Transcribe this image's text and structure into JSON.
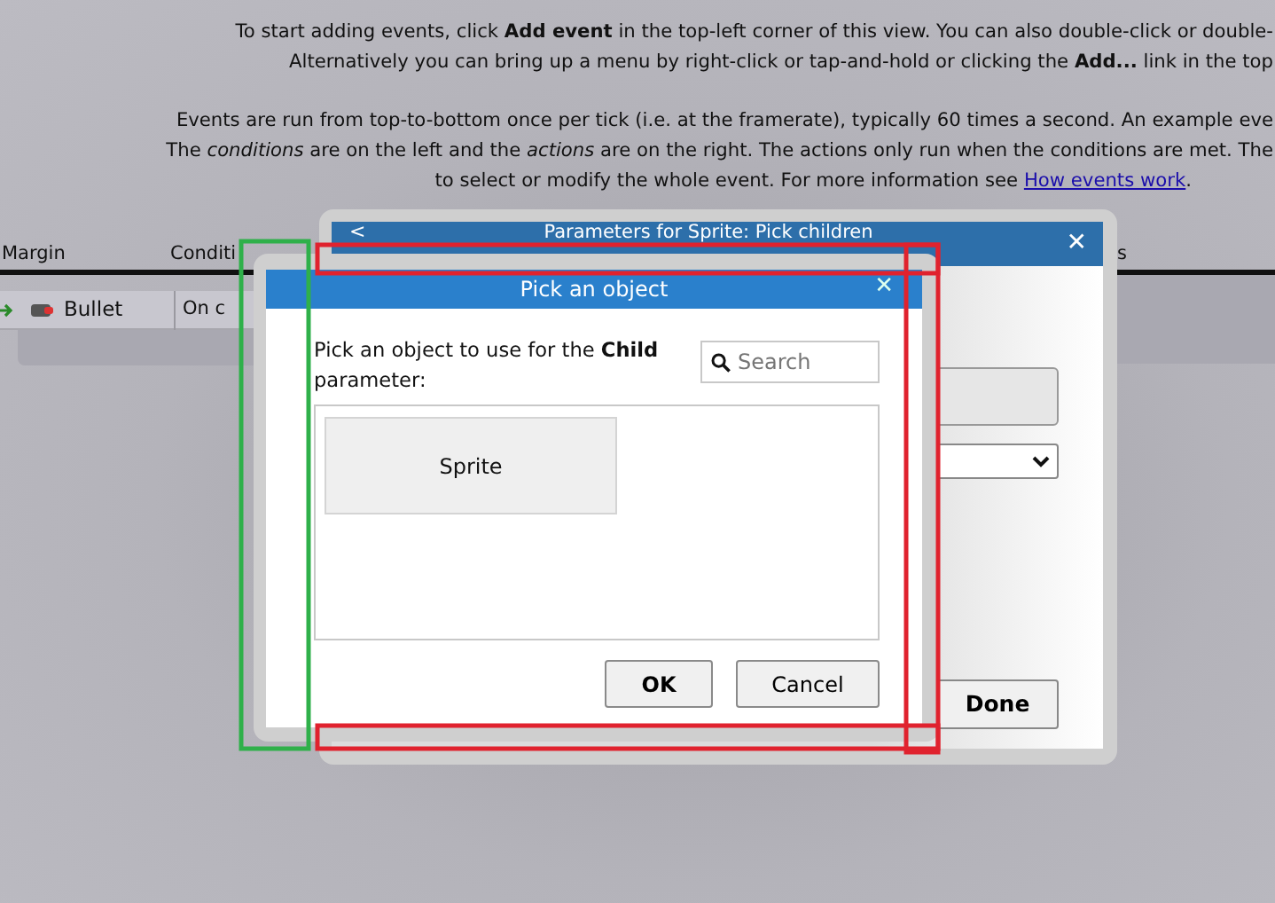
{
  "intro": [
    "To start adding events, click **Add event** in the top-left corner of this view. You can also double-click or double-",
    "Alternatively you can bring up a menu by right-click or tap-and-hold or clicking the **Add...** link in the top"
  ],
  "details": [
    {
      "text": "Events are run from top-to-bottom once per tick (i.e. at the framerate), typically 60 times a second. An example eve"
    },
    {
      "text": "The *conditions* are on the left and the *actions* are on the right. The actions only run when the conditions are met. The"
    },
    {
      "text": "to select or modify the whole event. For more information see",
      "link": "How events work",
      "after": "."
    }
  ],
  "event_sheet": {
    "columns": [
      "Margin",
      "Conditi",
      "s"
    ],
    "row": {
      "object": "Bullet",
      "condition": "On c"
    }
  },
  "parameters_dialog": {
    "back": "<",
    "title": "Parameters for Sprite: Pick children",
    "close": "✕",
    "done": "Done"
  },
  "pick_dialog": {
    "title": "Pick an object",
    "close": "✕",
    "prompt": "Pick an object to use for the **Child** parameter:",
    "search": {
      "placeholder": "Search"
    },
    "objects": [
      {
        "name": "Sprite",
        "selected": false
      }
    ],
    "buttons": [
      {
        "label": "OK",
        "kind": "default"
      },
      {
        "label": "Cancel",
        "kind": "plain"
      }
    ]
  },
  "annotations": [
    {
      "color": "#2fb04a"
    },
    {
      "color": "#e0222e"
    },
    {
      "color": "#e0222e"
    },
    {
      "color": "#e0222e"
    }
  ]
}
